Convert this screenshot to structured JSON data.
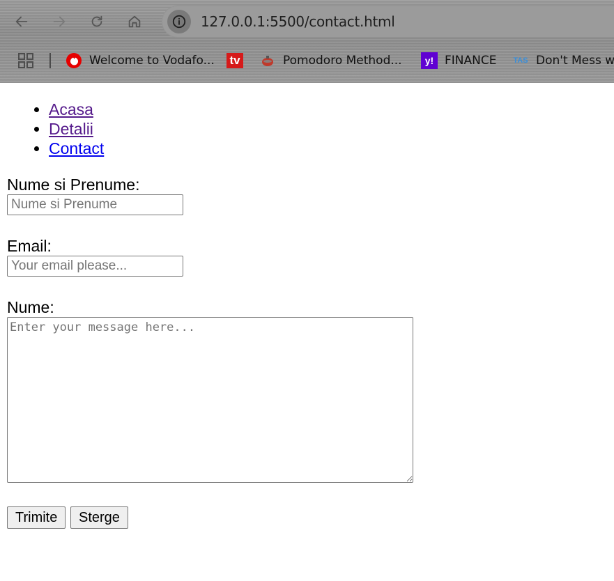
{
  "browser": {
    "url": "127.0.0.1:5500/contact.html",
    "bookmarks": [
      {
        "label": "Welcome to Vodafo...",
        "icon": "vodafone-icon"
      },
      {
        "label": "",
        "icon": "tv-icon",
        "icon_text": "tv"
      },
      {
        "label": "Pomodoro Method...",
        "icon": "tomato-timer-icon"
      },
      {
        "label": "FINANCE",
        "icon": "yahoo-finance-icon",
        "icon_text": "y!"
      },
      {
        "label": "Don't Mess wi",
        "icon": "tas-icon",
        "icon_text": "TAS"
      }
    ]
  },
  "nav": {
    "items": [
      {
        "label": "Acasa",
        "visited": true
      },
      {
        "label": "Detalii",
        "visited": true
      },
      {
        "label": "Contact",
        "visited": false
      }
    ]
  },
  "form": {
    "name_label": "Nume si Prenume:",
    "name_placeholder": "Nume si Prenume",
    "email_label": "Email:",
    "email_placeholder": "Your email please...",
    "message_label": "Nume:",
    "message_placeholder": "Enter your message here...",
    "submit_label": "Trimite",
    "reset_label": "Sterge"
  },
  "colors": {
    "visited_link": "#551a8b",
    "link": "#0000ee"
  }
}
